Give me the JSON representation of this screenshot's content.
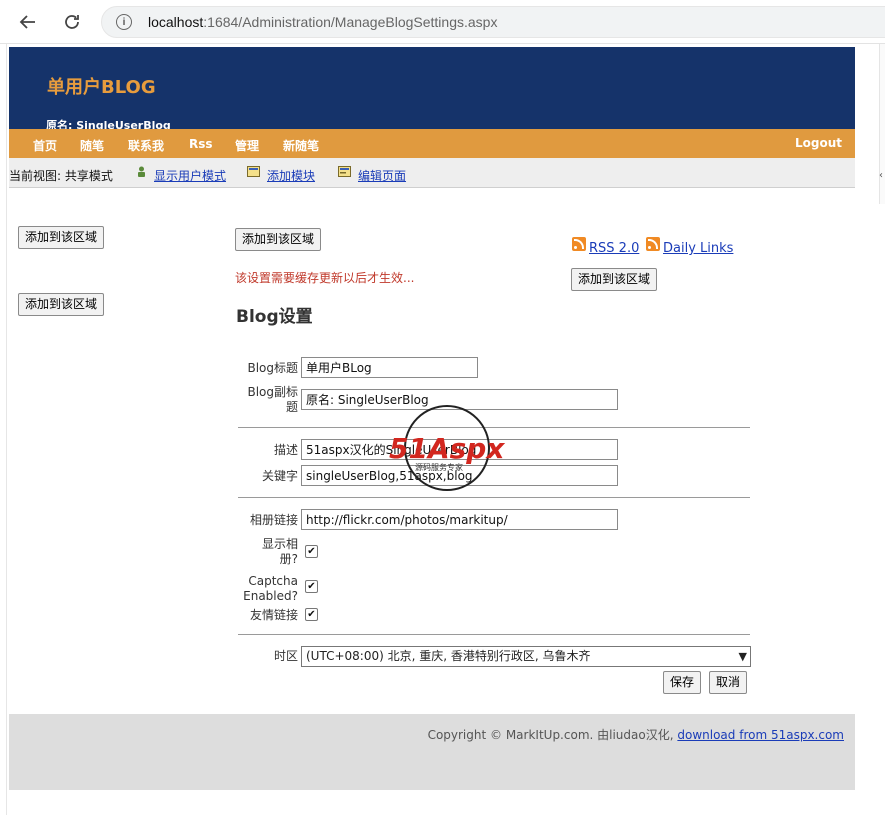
{
  "browser": {
    "url_host": "localhost",
    "url_rest": ":1684/Administration/ManageBlogSettings.aspx"
  },
  "header": {
    "title": "单用户BLOG",
    "subtitle": "原名: SingleUserBlog"
  },
  "nav": {
    "items": [
      "首页",
      "随笔",
      "联系我",
      "Rss",
      "管理",
      "新随笔"
    ],
    "logout": "Logout"
  },
  "viewbar": {
    "label": "当前视图: 共享模式",
    "links": [
      "显示用户模式",
      "添加模块",
      "编辑页面"
    ]
  },
  "zones": {
    "add_button_label": "添加到该区域"
  },
  "feeds": {
    "rss": "RSS 2.0",
    "daily": "Daily Links"
  },
  "settings": {
    "notice": "该设置需要缓存更新以后才生效...",
    "title": "Blog设置",
    "fields": {
      "blog_title_label": "Blog标题",
      "blog_title_value": "单用户BLog",
      "blog_subtitle_label": "Blog副标题",
      "blog_subtitle_value": "原名: SingleUserBlog",
      "description_label": "描述",
      "description_value": "51aspx汉化的SingleUserBlog",
      "keywords_label": "关键字",
      "keywords_value": "singleUserBlog,51aspx,blog",
      "album_label": "相册链接",
      "album_value": "http://flickr.com/photos/markitup/",
      "show_album_label": "显示相册?",
      "show_album_checked": true,
      "captcha_label": "Captcha Enabled?",
      "captcha_checked": true,
      "links_label": "友情链接",
      "links_checked": true,
      "timezone_label": "时区",
      "timezone_value": "(UTC+08:00) 北京, 重庆, 香港特别行政区, 乌鲁木齐"
    },
    "save_label": "保存",
    "cancel_label": "取消"
  },
  "watermark": {
    "main": "51Aspx",
    "sub": "源码服务专家"
  },
  "footer": {
    "copyright": "Copyright © MarkItUp.com. 由liudao汉化,",
    "link": "download from 51aspx.com"
  },
  "colors": {
    "header_bg": "#15336a",
    "accent": "#e09a3f",
    "title": "#e79c3d",
    "notice": "#c0392b",
    "link": "#1a3cb8"
  }
}
